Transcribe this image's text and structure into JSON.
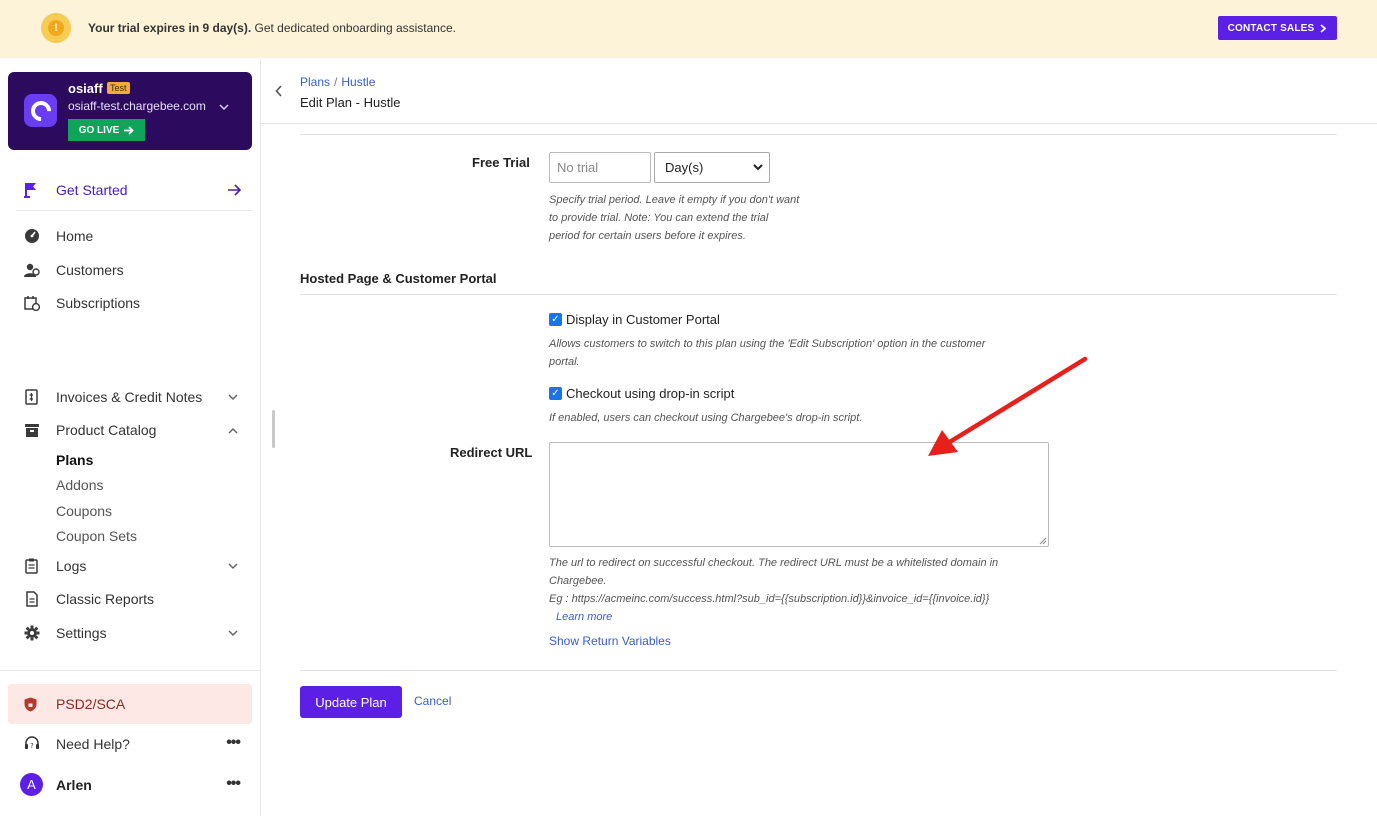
{
  "banner": {
    "message_bold": "Your trial expires in 9 day(s).",
    "message_rest": " Get dedicated onboarding assistance.",
    "cta_label": "CONTACT SALES",
    "warn_glyph": "!"
  },
  "site": {
    "name": "osiaff",
    "badge": "Test",
    "domain": "osiaff-test.chargebee.com",
    "go_live_label": "GO LIVE"
  },
  "sidebar": {
    "get_started": "Get Started",
    "items": [
      {
        "label": "Home",
        "icon": "dashboard-icon"
      },
      {
        "label": "Customers",
        "icon": "customers-icon"
      },
      {
        "label": "Subscriptions",
        "icon": "calendar-icon"
      },
      {
        "label": "Invoices & Credit Notes",
        "icon": "invoice-icon"
      },
      {
        "label": "Product Catalog",
        "icon": "catalog-icon"
      },
      {
        "label": "Logs",
        "icon": "clipboard-icon"
      },
      {
        "label": "Classic Reports",
        "icon": "report-icon"
      },
      {
        "label": "Settings",
        "icon": "gear-icon"
      }
    ],
    "catalog_sub": [
      "Plans",
      "Addons",
      "Coupons",
      "Coupon Sets"
    ],
    "psd2": "PSD2/SCA",
    "need_help": "Need Help?",
    "user": {
      "name": "Arlen",
      "initial": "A"
    }
  },
  "header": {
    "breadcrumb": [
      "Plans",
      "Hustle"
    ],
    "title": "Edit Plan - Hustle"
  },
  "form": {
    "free_trial": {
      "label": "Free Trial",
      "placeholder": "No trial",
      "unit": "Day(s)",
      "hint_lines": [
        "Specify trial period. Leave it empty if you don't want",
        "to provide trial. Note: You can extend the trial",
        "period for certain users before it expires."
      ]
    },
    "section_title": "Hosted Page & Customer Portal",
    "display_portal": {
      "label": "Display in Customer Portal",
      "checked": true,
      "hint_lines": [
        "Allows customers to switch to this plan using the 'Edit Subscription' option in the customer",
        "portal."
      ]
    },
    "checkout_dropin": {
      "label": "Checkout using drop-in script",
      "checked": true,
      "hint": "If enabled, users can checkout using Chargebee's drop-in script."
    },
    "redirect": {
      "label": "Redirect URL",
      "value": "",
      "hint_lines": [
        "The url to redirect on successful checkout. The redirect URL must be a whitelisted domain in",
        "Chargebee.",
        "Eg : https://acmeinc.com/success.html?sub_id={{subscription.id}}&invoice_id={{invoice.id}}"
      ],
      "learn_more": "Learn more",
      "show_vars": "Show Return Variables"
    },
    "update_label": "Update Plan",
    "cancel_label": "Cancel"
  },
  "colors": {
    "accent": "#5b1fe6",
    "banner_bg": "#fdf3d8",
    "site_card": "#2c0a5e",
    "go_live": "#0ea55a",
    "annotation_arrow": "#e8201c"
  }
}
